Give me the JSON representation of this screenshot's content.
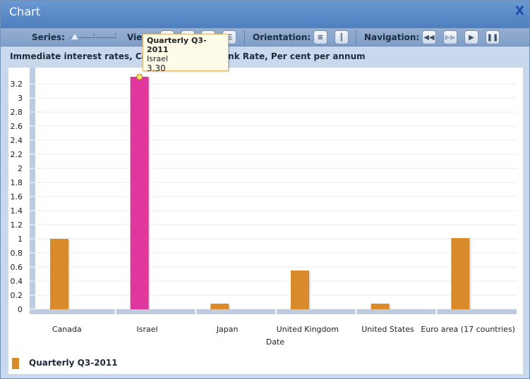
{
  "window": {
    "title": "Chart",
    "close_label": "X"
  },
  "toolbar": {
    "series_label": "Series:",
    "view_label": "View:",
    "orientation_label": "Orientation:",
    "navigation_label": "Navigation:",
    "view_icons": [
      "bar-chart-icon",
      "table-view-icon",
      "map-view-icon",
      "list-view-icon"
    ],
    "orientation_icons": [
      "horizontal-lines-icon",
      "vertical-lines-icon"
    ],
    "navigation_icons": [
      "rewind-icon",
      "fast-forward-icon",
      "play-icon",
      "pause-icon"
    ]
  },
  "subtitle": "Immediate interest rates, Call Money, Interbank Rate, Per cent per annum",
  "tooltip": {
    "series": "Quarterly Q3-2011",
    "category": "Israel",
    "value": "3.30"
  },
  "legend": {
    "label": "Quarterly Q3-2011",
    "color": "#d98a2b"
  },
  "colors": {
    "bar": "#d98a2b",
    "highlight": "#e0379d",
    "axis": "#bccbe0"
  },
  "chart_data": {
    "type": "bar",
    "title": "Immediate interest rates, Call Money, Interbank Rate, Per cent per annum",
    "xlabel": "Date",
    "ylabel": "",
    "categories": [
      "Canada",
      "Israel",
      "Japan",
      "United Kingdom",
      "United States",
      "Euro area (17 countries)"
    ],
    "series": [
      {
        "name": "Quarterly Q3-2011",
        "values": [
          1.0,
          3.3,
          0.08,
          0.55,
          0.08,
          1.01
        ]
      }
    ],
    "highlighted_index": 1,
    "ylim": [
      0,
      3.3
    ],
    "yticks": [
      "0",
      "0.2",
      "0.4",
      "0.6",
      "0.8",
      "1",
      "1.2",
      "1.4",
      "1.6",
      "1.8",
      "2",
      "2.2",
      "2.4",
      "2.6",
      "2.8",
      "3",
      "3.2"
    ],
    "grid": true,
    "legend_position": "bottom-left"
  }
}
